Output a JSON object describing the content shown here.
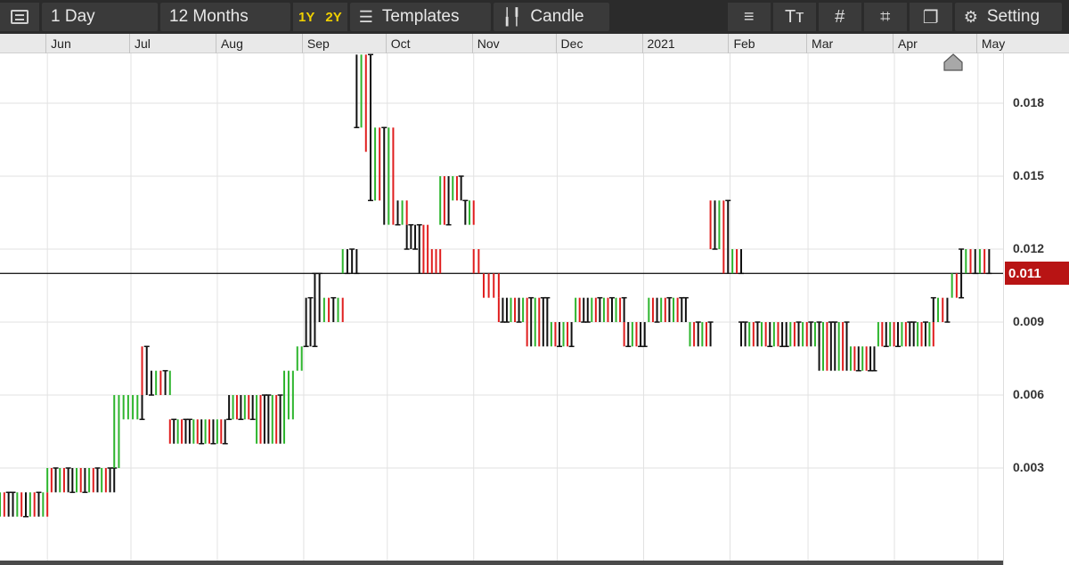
{
  "toolbar": {
    "interval_label": "1 Day",
    "range_label": "12 Months",
    "range_1y": "1Y",
    "range_2y": "2Y",
    "templates_label": "Templates",
    "chart_type_label": "Candle",
    "settings_label": "Setting",
    "icons": [
      "menu-icon",
      "templates-icon",
      "candle-icon",
      "indicator-icon",
      "text-icon",
      "grid-icon",
      "drawing-icon",
      "layers-icon",
      "gear-icon"
    ]
  },
  "timeline": {
    "months": [
      "Jun",
      "Jul",
      "Aug",
      "Sep",
      "Oct",
      "Nov",
      "Dec",
      "2021",
      "Feb",
      "Mar",
      "Apr",
      "May"
    ]
  },
  "colors": {
    "up": "#2db52d",
    "down": "#e01e1e",
    "flat": "#111111",
    "last_price_bg": "#b81414"
  },
  "chart_data": {
    "type": "ohlc",
    "title": "",
    "xlabel": "",
    "ylabel": "",
    "x_range": [
      "2020-05-15",
      "2021-05-10"
    ],
    "ylim": [
      0.0,
      0.0205
    ],
    "y_ticks": [
      "0.003",
      "0.006",
      "0.009",
      "0.012",
      "0.015",
      "0.018"
    ],
    "last_price": "0.011",
    "last_price_value": 0.011,
    "grid": true,
    "segments": [
      {
        "start": "2020-05-15",
        "end": "2020-06-01",
        "levels": [
          0.002,
          0.001,
          0.002,
          0.001
        ],
        "color": "mixed"
      },
      {
        "start": "2020-06-01",
        "end": "2020-06-25",
        "levels": [
          0.003,
          0.002,
          0.003,
          0.002
        ],
        "color": "mixed"
      },
      {
        "start": "2020-06-25",
        "end": "2020-07-05",
        "levels": [
          0.003,
          0.006,
          0.005,
          0.006
        ],
        "color": "up"
      },
      {
        "start": "2020-07-05",
        "end": "2020-07-15",
        "levels": [
          0.008,
          0.006,
          0.007,
          0.006
        ],
        "color": "mixed"
      },
      {
        "start": "2020-07-15",
        "end": "2020-08-25",
        "levels": [
          0.005,
          0.004,
          0.005,
          0.006,
          0.004
        ],
        "color": "mixed"
      },
      {
        "start": "2020-08-25",
        "end": "2020-09-05",
        "levels": [
          0.005,
          0.007,
          0.008,
          0.01
        ],
        "color": "up"
      },
      {
        "start": "2020-09-05",
        "end": "2020-09-15",
        "levels": [
          0.011,
          0.009,
          0.01,
          0.009
        ],
        "color": "mixed"
      },
      {
        "start": "2020-09-15",
        "end": "2020-09-20",
        "levels": [
          0.011,
          0.012
        ],
        "color": "up"
      },
      {
        "start": "2020-09-20",
        "end": "2020-09-25",
        "levels": [
          0.017,
          0.02,
          0.016
        ],
        "color": "mixed"
      },
      {
        "start": "2020-09-25",
        "end": "2020-10-08",
        "levels": [
          0.014,
          0.017,
          0.013,
          0.014
        ],
        "color": "mixed"
      },
      {
        "start": "2020-10-08",
        "end": "2020-10-20",
        "levels": [
          0.012,
          0.013,
          0.011,
          0.012
        ],
        "color": "down"
      },
      {
        "start": "2020-10-20",
        "end": "2020-11-01",
        "levels": [
          0.013,
          0.015,
          0.014,
          0.013
        ],
        "color": "mixed"
      },
      {
        "start": "2020-11-01",
        "end": "2020-11-10",
        "levels": [
          0.012,
          0.011,
          0.01,
          0.011
        ],
        "color": "down"
      },
      {
        "start": "2020-11-10",
        "end": "2020-12-25",
        "levels": [
          0.009,
          0.01,
          0.008,
          0.009,
          0.01,
          0.009
        ],
        "color": "mixed"
      },
      {
        "start": "2020-12-25",
        "end": "2021-01-25",
        "levels": [
          0.008,
          0.009,
          0.01,
          0.009,
          0.008
        ],
        "color": "mixed"
      },
      {
        "start": "2021-01-25",
        "end": "2021-02-05",
        "levels": [
          0.012,
          0.014,
          0.011,
          0.012
        ],
        "color": "mixed"
      },
      {
        "start": "2021-02-05",
        "end": "2021-03-05",
        "levels": [
          0.009,
          0.008,
          0.009,
          0.008
        ],
        "color": "mixed"
      },
      {
        "start": "2021-03-05",
        "end": "2021-04-15",
        "levels": [
          0.009,
          0.007,
          0.008,
          0.009,
          0.008
        ],
        "color": "mixed"
      },
      {
        "start": "2021-04-15",
        "end": "2021-04-25",
        "levels": [
          0.01,
          0.009,
          0.01,
          0.011
        ],
        "color": "mixed"
      },
      {
        "start": "2021-04-25",
        "end": "2021-05-05",
        "levels": [
          0.012,
          0.011,
          0.012
        ],
        "color": "mixed"
      }
    ]
  }
}
